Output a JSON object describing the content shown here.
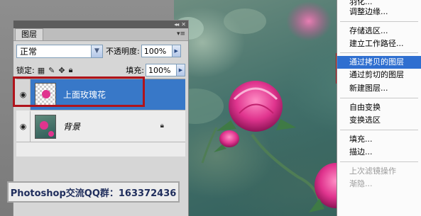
{
  "panel": {
    "tab_label": "图层",
    "blend_mode": "正常",
    "opacity_label": "不透明度:",
    "opacity_value": "100%",
    "lock_label": "锁定:",
    "fill_label": "填充:",
    "fill_value": "100%",
    "collapse_glyph": "◂◂",
    "close_glyph": "✕",
    "menu_glyph": "▾≡"
  },
  "layers": [
    {
      "name": "上面玫瑰花",
      "selected": true,
      "italic": false
    },
    {
      "name": "背景",
      "selected": false,
      "italic": true
    }
  ],
  "banner": {
    "text": "Photoshop交流QQ群：163372436"
  },
  "context_menu": {
    "items": [
      {
        "label": "羽化...",
        "state": "normal"
      },
      {
        "label": "调整边缘...",
        "state": "normal"
      },
      {
        "label": "存储选区...",
        "state": "normal"
      },
      {
        "label": "建立工作路径...",
        "state": "normal"
      },
      {
        "label": "通过拷贝的图层",
        "state": "highlighted"
      },
      {
        "label": "通过剪切的图层",
        "state": "normal"
      },
      {
        "label": "新建图层...",
        "state": "normal"
      },
      {
        "label": "自由变换",
        "state": "normal"
      },
      {
        "label": "变换选区",
        "state": "normal"
      },
      {
        "label": "填充...",
        "state": "normal"
      },
      {
        "label": "描边...",
        "state": "normal"
      },
      {
        "label": "上次滤镜操作",
        "state": "disabled"
      },
      {
        "label": "渐隐...",
        "state": "disabled"
      }
    ]
  },
  "colors": {
    "highlight_red": "#b0131b",
    "selected_blue": "#3878c8",
    "menu_highlight": "#2f6fd0"
  },
  "icons": {
    "visibility": "eye-icon",
    "lock_transparent": "lock-transparent-pixels-icon",
    "lock_image": "brush-icon",
    "lock_position": "move-icon",
    "lock_all": "lock-icon",
    "background_lock": "lock-icon"
  }
}
